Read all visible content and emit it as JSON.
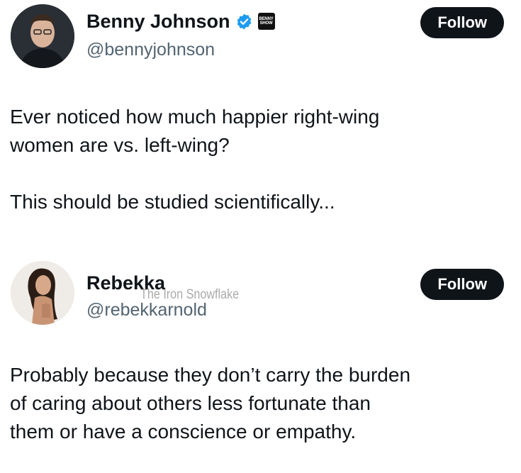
{
  "posts": [
    {
      "author": {
        "name": "Benny Johnson",
        "handle": "@bennyjohnson",
        "verified": true,
        "affiliation_badge": "BENNY SHOW"
      },
      "follow_label": "Follow",
      "text": "Ever noticed how much happier right-wing\nwomen are vs. left-wing?\n\nThis should be studied scientifically..."
    },
    {
      "author": {
        "name": "Rebekka",
        "handle": "@rebekkarnold"
      },
      "follow_label": "Follow",
      "text": "Probably because they don’t carry the burden\nof caring about others less fortunate than\nthem or have a conscience or empathy."
    }
  ],
  "watermark": "The Iron Snowflake",
  "colors": {
    "text": "#0f1419",
    "secondary": "#536471",
    "button_bg": "#0f1419",
    "button_text": "#ffffff",
    "verified": "#1d9bf0"
  }
}
